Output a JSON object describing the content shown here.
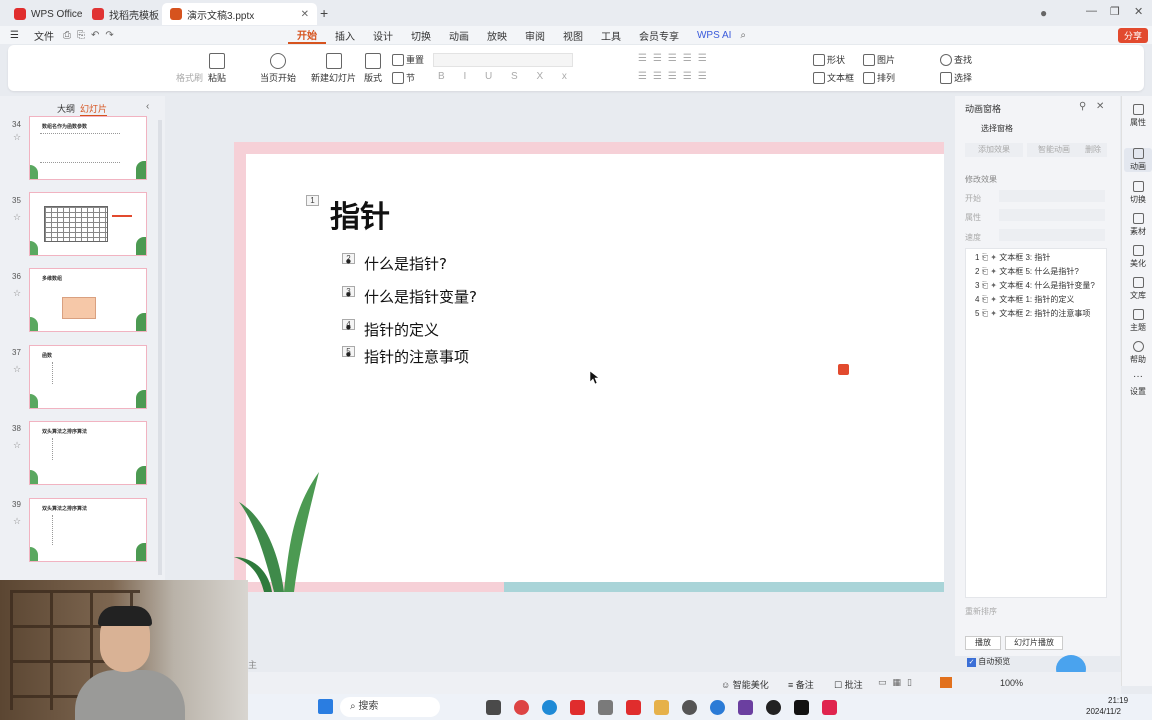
{
  "tabs": [
    {
      "label": "WPS Office",
      "color": "#e02d2d"
    },
    {
      "label": "找稻壳模板",
      "color": "#e03434"
    },
    {
      "label": "演示文稿3.pptx",
      "color": "#d6531e"
    }
  ],
  "menu": {
    "file": "文件",
    "items": [
      "开始",
      "插入",
      "设计",
      "切换",
      "动画",
      "放映",
      "审阅",
      "视图",
      "工具",
      "会员专享"
    ],
    "wps_ai": "WPS AI",
    "share": "分享"
  },
  "ribbon": {
    "format_painter": "格式刷",
    "paste": "粘贴",
    "play_from_current": "当页开始",
    "new_slide": "新建幻灯片",
    "layout": "版式",
    "reset": "重置",
    "section": "节",
    "shape": "形状",
    "picture": "图片",
    "find": "查找",
    "textbox": "文本框",
    "arrange": "排列",
    "select": "选择"
  },
  "left_panel": {
    "outline_tab": "大纲",
    "slides_tab": "幻灯片",
    "thumbs": [
      {
        "num": "34",
        "title": "数组名作为函数参数"
      },
      {
        "num": "35",
        "title": ""
      },
      {
        "num": "36",
        "title": "多维数组"
      },
      {
        "num": "37",
        "title": "函数"
      },
      {
        "num": "38",
        "title": "双头算法之排序算法"
      },
      {
        "num": "39",
        "title": "双头算法之排序算法"
      }
    ]
  },
  "slide": {
    "title": "指针",
    "title_badge": "1",
    "bullets": [
      {
        "badge": "2",
        "text": "什么是指针?"
      },
      {
        "badge": "3",
        "text": "什么是指针变量?"
      },
      {
        "badge": "4",
        "text": "指针的定义"
      },
      {
        "badge": "5",
        "text": "指针的注意事项"
      }
    ]
  },
  "anim_pane": {
    "title": "动画窗格",
    "select_pane": "选择窗格",
    "add_effect": "添加效果",
    "smart_anim": "智能动画",
    "delete": "删除",
    "modify_effect": "修改效果",
    "start": "开始",
    "property": "属性",
    "speed": "速度",
    "items": [
      {
        "n": "1",
        "text": "文本框 3: 指针"
      },
      {
        "n": "2",
        "text": "文本框 5: 什么是指针?"
      },
      {
        "n": "3",
        "text": "文本框 4: 什么是指针变量?"
      },
      {
        "n": "4",
        "text": "文本框 1: 指针的定义"
      },
      {
        "n": "5",
        "text": "文本框 2: 指针的注意事项"
      }
    ],
    "reorder": "重新排序",
    "play": "播放",
    "slideshow": "幻灯片播放",
    "autopreview": "自动预览"
  },
  "sidebar": [
    "属性",
    "动画",
    "切换",
    "素材",
    "美化",
    "文库",
    "主题",
    "帮助",
    "设置"
  ],
  "status": {
    "smart_beautify": "智能美化",
    "notes": "备注",
    "comment": "批注",
    "zoom": "100%",
    "notes_placeholder": "主"
  },
  "taskbar": {
    "search": "搜索",
    "time": "21:19",
    "date": "2024/11/2"
  }
}
